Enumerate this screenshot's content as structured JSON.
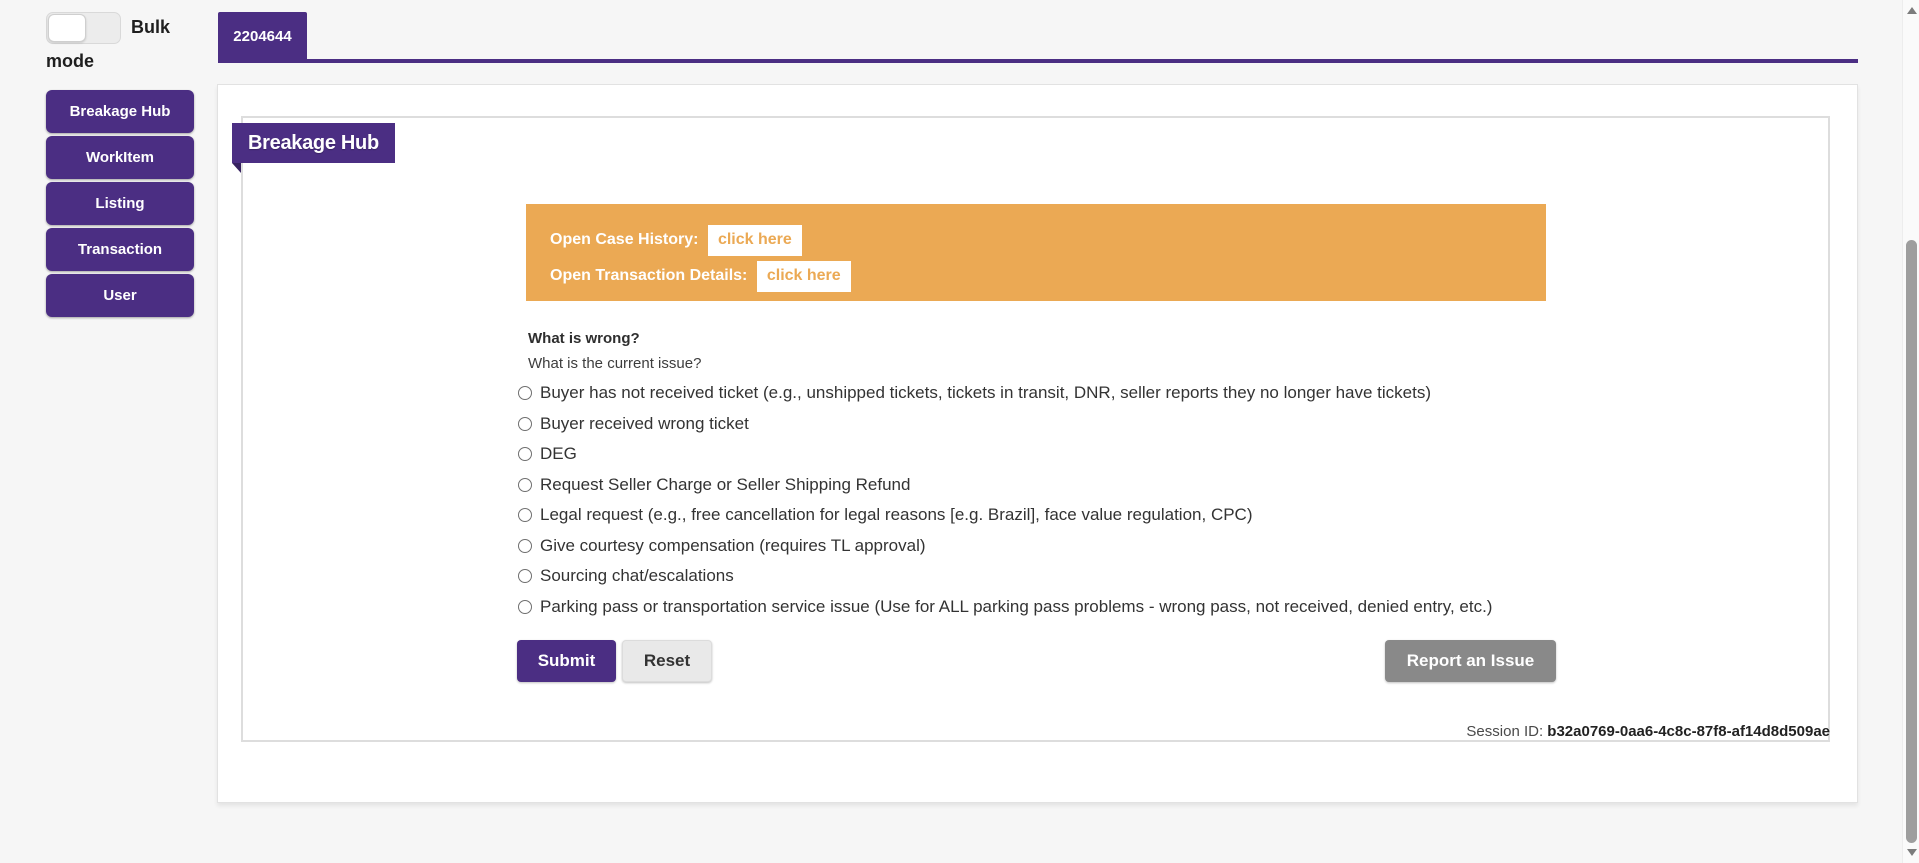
{
  "colors": {
    "accent_purple": "#4b2e83",
    "ribbon_fold_purple": "#362160",
    "banner_orange": "#eba954",
    "report_button_gray": "#898989"
  },
  "sidebar": {
    "bulk_mode_label": "Bulk mode",
    "items": [
      {
        "label": "Breakage Hub"
      },
      {
        "label": "WorkItem"
      },
      {
        "label": "Listing"
      },
      {
        "label": "Transaction"
      },
      {
        "label": "User"
      }
    ]
  },
  "tabs": [
    {
      "label": "2204644",
      "active": true
    }
  ],
  "main": {
    "ribbon_title": "Breakage Hub",
    "banner": {
      "rows": [
        {
          "label": "Open Case History:",
          "link": "click here"
        },
        {
          "label": "Open Transaction Details:",
          "link": "click here"
        }
      ]
    },
    "form": {
      "question_title": "What is wrong?",
      "question_subtitle": "What is the current issue?",
      "options": [
        "Buyer has not received ticket (e.g., unshipped tickets, tickets in transit, DNR, seller reports they no longer have tickets)",
        "Buyer received wrong ticket",
        "DEG",
        "Request Seller Charge or Seller Shipping Refund",
        "Legal request (e.g., free cancellation for legal reasons [e.g. Brazil], face value regulation, CPC)",
        "Give courtesy compensation (requires TL approval)",
        "Sourcing chat/escalations",
        "Parking pass or transportation service issue (Use for ALL parking pass problems - wrong pass, not received, denied entry, etc.)"
      ],
      "submit_label": "Submit",
      "reset_label": "Reset",
      "report_label": "Report an Issue"
    },
    "session": {
      "label": "Session ID:",
      "value": "b32a0769-0aa6-4c8c-87f8-af14d8d509ae"
    }
  }
}
